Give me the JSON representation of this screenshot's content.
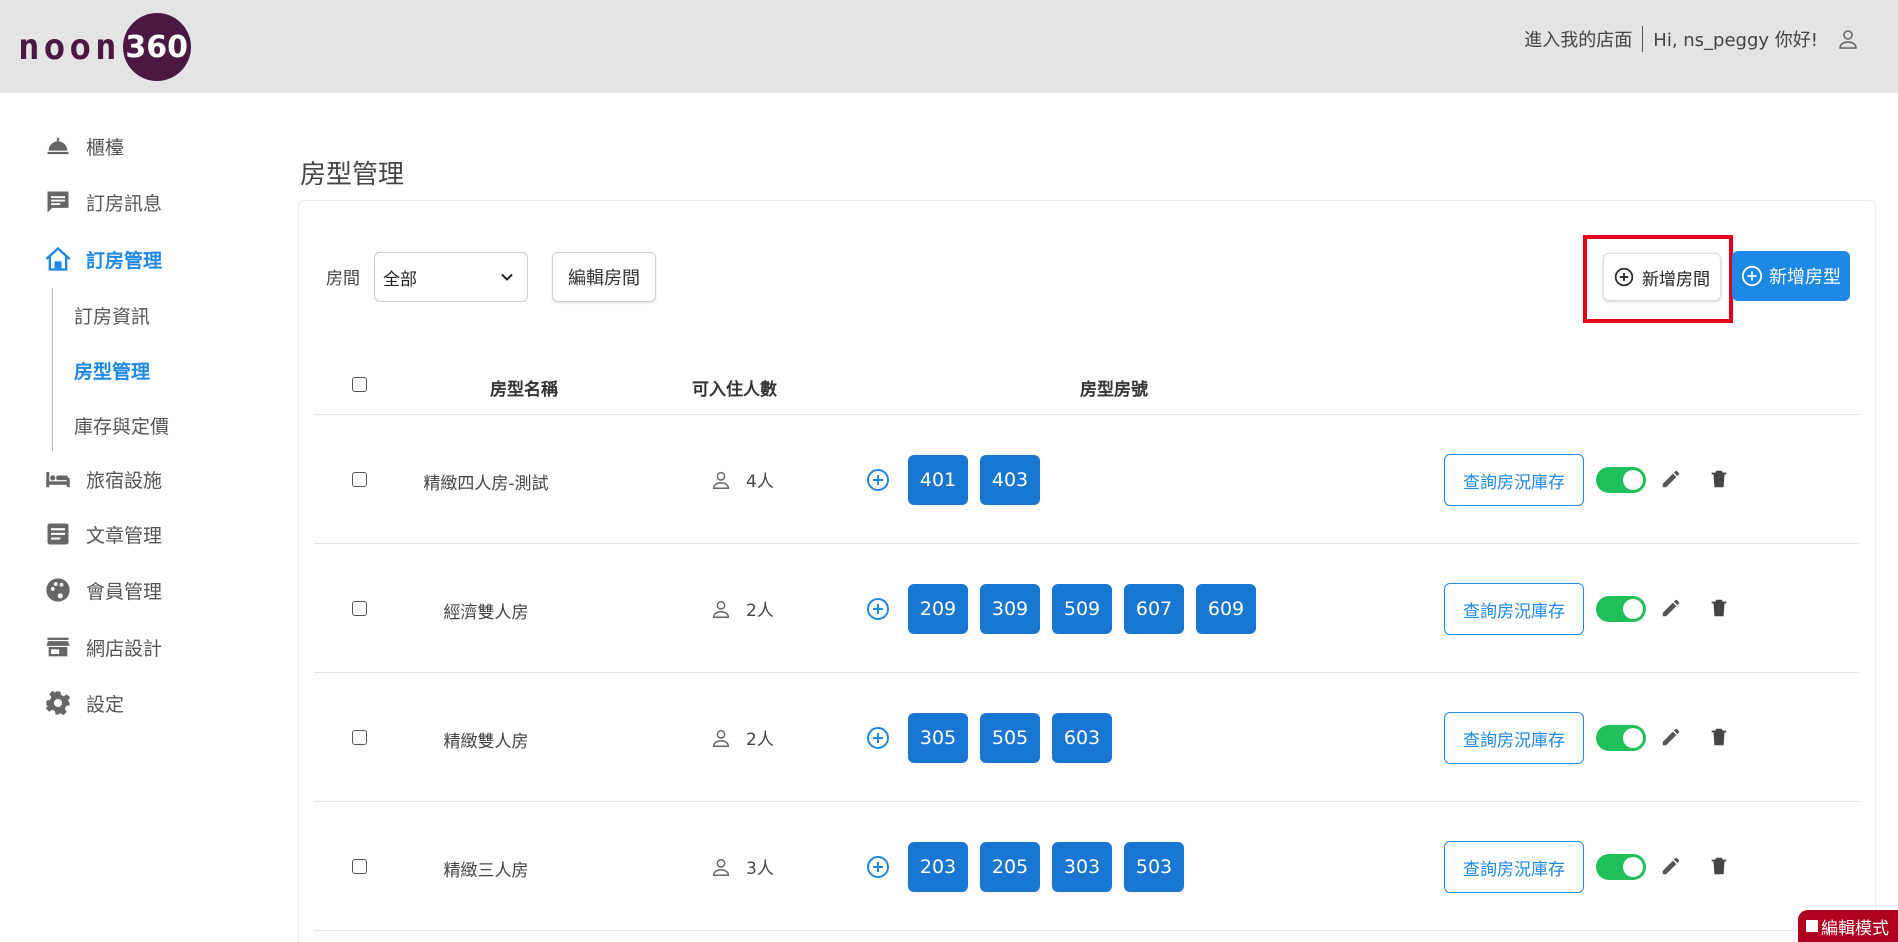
{
  "header": {
    "logo_text": "noon",
    "logo_badge": "360",
    "enter_store": "進入我的店面",
    "greeting": "Hi, ns_peggy 你好!",
    "user_icon": "user-icon"
  },
  "sidebar": {
    "items": [
      {
        "label": "櫃檯",
        "icon": "bell-icon"
      },
      {
        "label": "訂房訊息",
        "icon": "message-icon"
      },
      {
        "label": "訂房管理",
        "icon": "house-icon"
      },
      {
        "label": "旅宿設施",
        "icon": "bed-icon"
      },
      {
        "label": "文章管理",
        "icon": "article-icon"
      },
      {
        "label": "會員管理",
        "icon": "palette-icon"
      },
      {
        "label": "網店設計",
        "icon": "store-icon"
      },
      {
        "label": "設定",
        "icon": "gear-icon"
      }
    ],
    "subitems": [
      {
        "label": "訂房資訊"
      },
      {
        "label": "房型管理"
      },
      {
        "label": "庫存與定價"
      }
    ],
    "active_item": "訂房管理",
    "active_subitem": "房型管理"
  },
  "main": {
    "title": "房型管理",
    "filter_label": "房間",
    "filter_value": "全部",
    "edit_rooms_label": "編輯房間",
    "add_room_label": "新增房間",
    "add_room_type_label": "新增房型",
    "accent_color": "#1e88e5",
    "highlight_color": "#e3001b"
  },
  "table": {
    "columns": [
      "房型名稱",
      "可入住人數",
      "房型房號"
    ],
    "query_label": "查詢房況庫存",
    "rows": [
      {
        "name": "精緻四人房-測試",
        "capacity": "4人",
        "rooms": [
          "401",
          "403"
        ],
        "enabled": true
      },
      {
        "name": "經濟雙人房",
        "capacity": "2人",
        "rooms": [
          "209",
          "309",
          "509",
          "607",
          "609"
        ],
        "enabled": true
      },
      {
        "name": "精緻雙人房",
        "capacity": "2人",
        "rooms": [
          "305",
          "505",
          "603"
        ],
        "enabled": true
      },
      {
        "name": "精緻三人房",
        "capacity": "3人",
        "rooms": [
          "203",
          "205",
          "303",
          "503"
        ],
        "enabled": true
      }
    ]
  },
  "footer": {
    "edit_mode_label": "編輯模式"
  }
}
